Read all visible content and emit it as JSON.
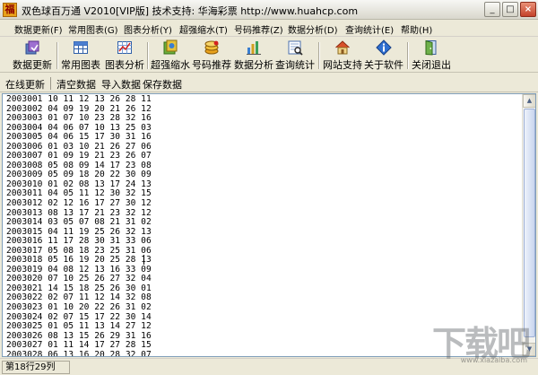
{
  "window": {
    "title": "双色球百万通  V2010[VIP版]   技术支持: 华海彩票 http://www.huahcp.com",
    "icon_glyph": "福",
    "controls": {
      "minimize": "_",
      "maximize": "□",
      "close": "×"
    }
  },
  "menu": [
    "数据更新(F)",
    "常用图表(G)",
    "图表分析(Y)",
    "超强缩水(T)",
    "号码推荐(Z)",
    "数据分析(D)",
    "查询统计(E)",
    "帮助(H)"
  ],
  "toolbar": {
    "buttons": [
      {
        "label": "数据更新",
        "icon": "data-update-icon"
      },
      {
        "label": "常用图表",
        "icon": "grid-chart-icon"
      },
      {
        "label": "图表分析",
        "icon": "chart-analysis-icon"
      },
      {
        "label": "超强缩水",
        "icon": "filter-icon"
      },
      {
        "label": "号码推荐",
        "icon": "recommend-icon"
      },
      {
        "label": "数据分析",
        "icon": "data-analysis-icon"
      },
      {
        "label": "查询统计",
        "icon": "query-stats-icon"
      },
      {
        "label": "网站支持",
        "icon": "home-icon"
      },
      {
        "label": "关于软件",
        "icon": "info-icon"
      },
      {
        "label": "关闭退出",
        "icon": "exit-door-icon"
      }
    ]
  },
  "commands": {
    "online_update": "在线更新",
    "clear": "清空数据",
    "import": "导入数据",
    "save": "保存数据"
  },
  "records": [
    "2003001 10 11 12 13 26 28 11",
    "2003002 04 09 19 20 21 26 12",
    "2003003 01 07 10 23 28 32 16",
    "2003004 04 06 07 10 13 25 03",
    "2003005 04 06 15 17 30 31 16",
    "2003006 01 03 10 21 26 27 06",
    "2003007 01 09 19 21 23 26 07",
    "2003008 05 08 09 14 17 23 08",
    "2003009 05 09 18 20 22 30 09",
    "2003010 01 02 08 13 17 24 13",
    "2003011 04 05 11 12 30 32 15",
    "2003012 02 12 16 17 27 30 12",
    "2003013 08 13 17 21 23 32 12",
    "2003014 03 05 07 08 21 31 02",
    "2003015 04 11 19 25 26 32 13",
    "2003016 11 17 28 30 31 33 06",
    "2003017 05 08 18 23 25 31 06",
    "2003018 05 16 19 20 25 28 13",
    "2003019 04 08 12 13 16 33 09",
    "2003020 07 10 25 26 27 32 04",
    "2003021 14 15 18 25 26 30 01",
    "2003022 02 07 11 12 14 32 08",
    "2003023 01 10 20 22 26 31 02",
    "2003024 02 07 15 17 22 30 14",
    "2003025 01 05 11 13 14 27 12",
    "2003026 08 13 15 26 29 31 16",
    "2003027 01 11 14 17 27 28 15",
    "2003028 06 13 16 20 28 32 07"
  ],
  "status": {
    "position": "第18行29列"
  },
  "watermark": {
    "main": "下载吧",
    "sub": "www.xiazaiba.com"
  }
}
